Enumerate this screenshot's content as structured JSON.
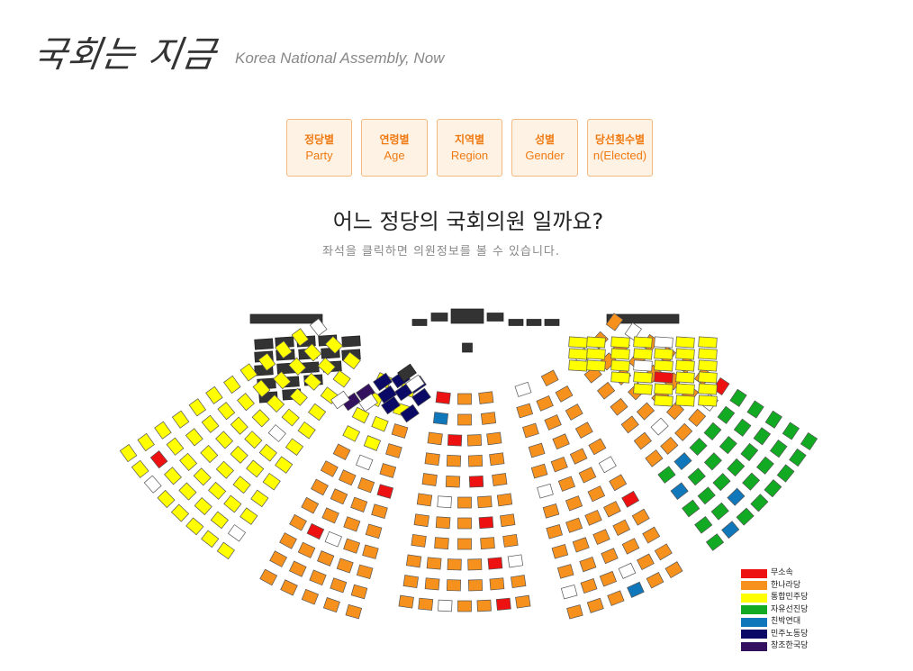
{
  "header": {
    "logo_text": "국회는 지금",
    "subtitle": "Korea National Assembly, Now"
  },
  "tabs": [
    {
      "ko": "정당별",
      "en": "Party"
    },
    {
      "ko": "연령별",
      "en": "Age"
    },
    {
      "ko": "지역별",
      "en": "Region"
    },
    {
      "ko": "성별",
      "en": "Gender"
    },
    {
      "ko": "당선횟수별",
      "en": "n(Elected)"
    }
  ],
  "main": {
    "question": "어느 정당의 국회의원 일까요?",
    "hint": "좌석을 클릭하면 의원정보를 볼 수 있습니다."
  },
  "legend": [
    {
      "label": "무소속",
      "color": "#ee1111"
    },
    {
      "label": "한나라당",
      "color": "#f7911e"
    },
    {
      "label": "통합민주당",
      "color": "#ffff00"
    },
    {
      "label": "자유선진당",
      "color": "#11aa22"
    },
    {
      "label": "친박연대",
      "color": "#1177bb"
    },
    {
      "label": "민주노동당",
      "color": "#0a0a66"
    },
    {
      "label": "창조한국당",
      "color": "#33115e"
    }
  ],
  "colors": {
    "staff_seat": "#333333",
    "empty_seat": "#ffffff",
    "tab_text": "#f07a12",
    "tab_border": "#f4b97c",
    "tab_bg": "#fdf2e4"
  }
}
